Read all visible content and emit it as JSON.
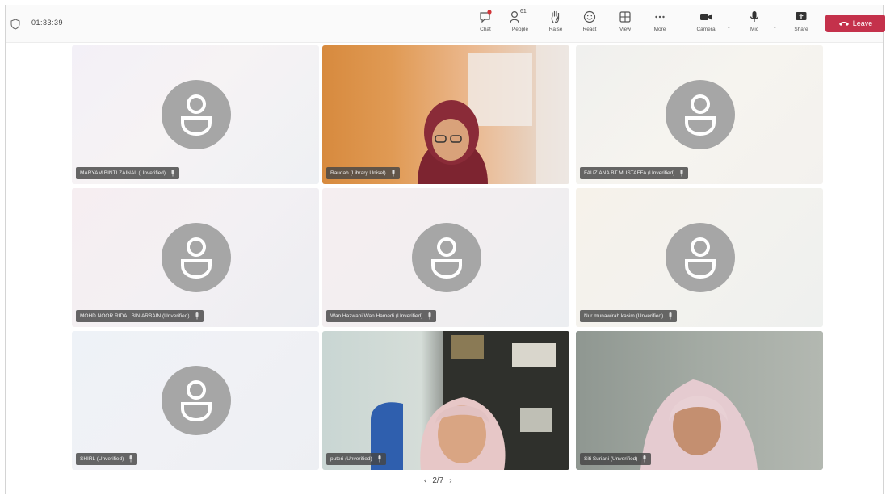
{
  "toolbar": {
    "timer": "01:33:39",
    "chat_label": "Chat",
    "people_label": "People",
    "people_count": "61",
    "raise_label": "Raise",
    "react_label": "React",
    "view_label": "View",
    "more_label": "More",
    "camera_label": "Camera",
    "mic_label": "Mic",
    "share_label": "Share",
    "leave_label": "Leave",
    "leave_color": "#c4314b"
  },
  "participants": [
    {
      "name": "MARYAM BINTI ZAINAL (Unverified)",
      "video": false
    },
    {
      "name": "Raudah (Library Unisel)",
      "video": true
    },
    {
      "name": "FAUZIANA BT MUSTAFFA (Unverified)",
      "video": false
    },
    {
      "name": "MOHD NOOR RIDAL BIN ARBAIN (Unverified)",
      "video": false
    },
    {
      "name": "Wan Hazwani Wan Hamedi (Unverified)",
      "video": false
    },
    {
      "name": "Nur munawirah kasim (Unverified)",
      "video": false
    },
    {
      "name": "SHIRL (Unverified)",
      "video": false
    },
    {
      "name": "puteri (Unverified)",
      "video": true
    },
    {
      "name": "Siti Suriani (Unverified)",
      "video": true
    }
  ],
  "pager": {
    "prev_icon": "chevron-left-icon",
    "page": "2/7",
    "next_icon": "chevron-right-icon"
  }
}
